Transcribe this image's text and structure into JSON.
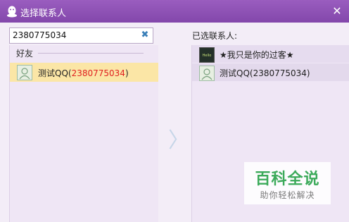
{
  "window": {
    "title": "选择联系人",
    "close_glyph": "✕",
    "accent": "#8e52b3"
  },
  "search": {
    "value": "2380775034",
    "clear_glyph": "✖"
  },
  "left": {
    "group_label": "好友",
    "friend": {
      "name": "测试QQ",
      "open_paren": "(",
      "qq": "2380775034",
      "close_paren": ")",
      "highlight": "#fbe6a6"
    }
  },
  "arrow_glyph": "〉",
  "right": {
    "label": "已选联系人:",
    "items": [
      {
        "name": "★我只是你的过客★",
        "avatar": "dark-photo-avatar"
      },
      {
        "name": "测试QQ(2380775034)",
        "avatar": "default-avatar"
      }
    ]
  },
  "watermark": {
    "title": "百科全说",
    "subtitle": "助你轻松解决"
  }
}
